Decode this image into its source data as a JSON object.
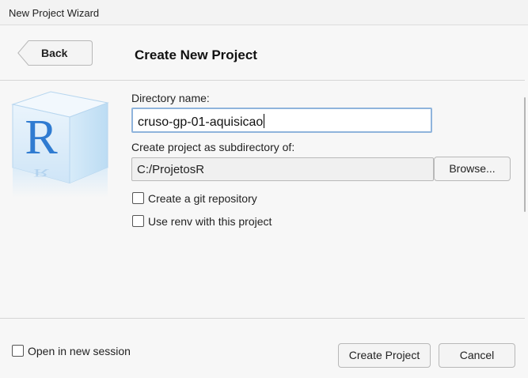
{
  "window": {
    "title": "New Project Wizard"
  },
  "header": {
    "back_label": "Back",
    "title": "Create New Project"
  },
  "form": {
    "directory_label": "Directory name:",
    "directory_value": "cruso-gp-01-aquisicao",
    "subdirectory_label": "Create project as subdirectory of:",
    "subdirectory_value": "C:/ProjetosR",
    "browse_label": "Browse...",
    "git_label": "Create a git repository",
    "git_checked": false,
    "renv_label": "Use renv with this project",
    "renv_checked": false
  },
  "footer": {
    "new_session_label": "Open in new session",
    "new_session_checked": false,
    "create_label": "Create Project",
    "cancel_label": "Cancel"
  },
  "logo": {
    "icon": "r-project-logo-icon",
    "letter": "R",
    "color": "#2f7bd1"
  },
  "colors": {
    "accent_focus": "#8fb4dc",
    "background": "#f7f7f7"
  }
}
